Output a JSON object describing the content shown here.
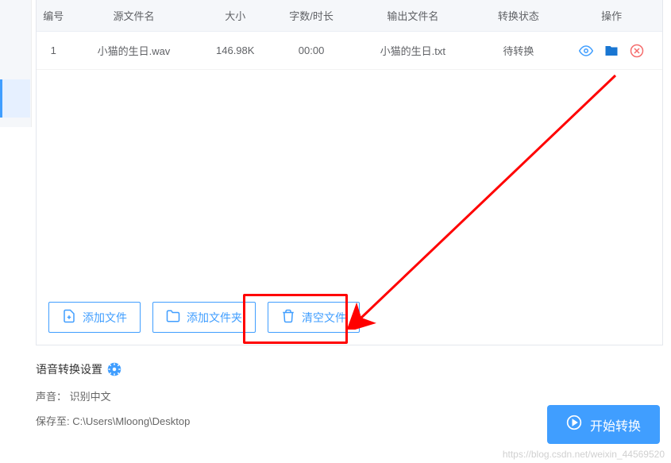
{
  "table": {
    "headers": {
      "num": "编号",
      "source": "源文件名",
      "size": "大小",
      "duration": "字数/时长",
      "output": "输出文件名",
      "status": "转换状态",
      "ops": "操作"
    },
    "rows": [
      {
        "num": "1",
        "source": "小猫的生日.wav",
        "size": "146.98K",
        "duration": "00:00",
        "output": "小猫的生日.txt",
        "status": "待转换"
      }
    ]
  },
  "buttons": {
    "add_file": "添加文件",
    "add_folder": "添加文件夹",
    "clear_files": "清空文件",
    "start": "开始转换"
  },
  "settings": {
    "title": "语音转换设置",
    "voice_label": "声音：",
    "voice_value": "识别中文",
    "save_label": "保存至:",
    "save_path": "C:\\Users\\Mloong\\Desktop"
  },
  "watermark": "https://blog.csdn.net/weixin_44569520"
}
